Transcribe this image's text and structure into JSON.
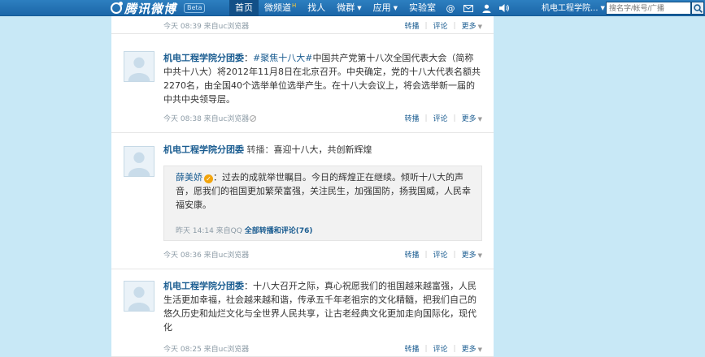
{
  "header": {
    "logo_text": "腾讯微博",
    "beta_label": "Beta",
    "nav": [
      {
        "label": "首页",
        "active": true
      },
      {
        "label": "微频道",
        "badge": "H"
      },
      {
        "label": "找人"
      },
      {
        "label": "微群",
        "dropdown": true
      },
      {
        "label": "应用",
        "dropdown": true
      },
      {
        "label": "实验室"
      }
    ],
    "icons": [
      "at-icon",
      "mail-icon",
      "user-icon",
      "speaker-icon"
    ],
    "user_name": "机电工程学院...",
    "search_placeholder": "搜名字/帐号/广播"
  },
  "feed": [
    {
      "meta": "今天 08:39 来自uc浏览器",
      "actions": {
        "forward": "转播",
        "comment": "评论",
        "more": "更多"
      }
    },
    {
      "author": "机电工程学院分团委",
      "author_suffix": "：",
      "topic": "#聚焦十八大#",
      "text": "中国共产党第十八次全国代表大会（简称中共十八大）将2012年11月8日在北京召开。中央确定，党的十八大代表名额共2270名，由全国40个选举单位选举产生。在十八大会议上，将会选举新一届的中共中央领导层。",
      "meta": "今天 08:38 来自uc浏览器",
      "actions": {
        "forward": "转播",
        "comment": "评论",
        "more": "更多"
      }
    },
    {
      "author": "机电工程学院分团委",
      "forward_label": "转播：",
      "text": "喜迎十八大，共创新辉煌",
      "quote": {
        "author": "薛美娇",
        "badge": "✓",
        "text": "：过去的成就举世瞩目。今日的辉煌正在继续。倾听十八大的声音，愿我们的祖国更加繁荣富强，关注民生，加强国防，扬我国威，人民幸福安康。",
        "meta": "昨天 14:14 来自QQ",
        "link": "全部转播和评论(76)"
      },
      "meta": "今天 08:36 来自uc浏览器",
      "actions": {
        "forward": "转播",
        "comment": "评论",
        "more": "更多"
      }
    },
    {
      "author": "机电工程学院分团委",
      "author_suffix": "：",
      "text": "十八大召开之际，真心祝愿我们的祖国越来越富强，人民生活更加幸福，社会越来越和谐，传承五千年老祖宗的文化精髓，把我们自己的悠久历史和灿烂文化与全世界人民共享，让古老经典文化更加走向国际化，现代化",
      "meta": "今天 08:25 来自uc浏览器",
      "actions": {
        "forward": "转播",
        "comment": "评论",
        "more": "更多"
      }
    }
  ],
  "colors": {
    "background": "#c8e8f6",
    "topbar": "#1b66a8",
    "link": "#1b5d91"
  }
}
